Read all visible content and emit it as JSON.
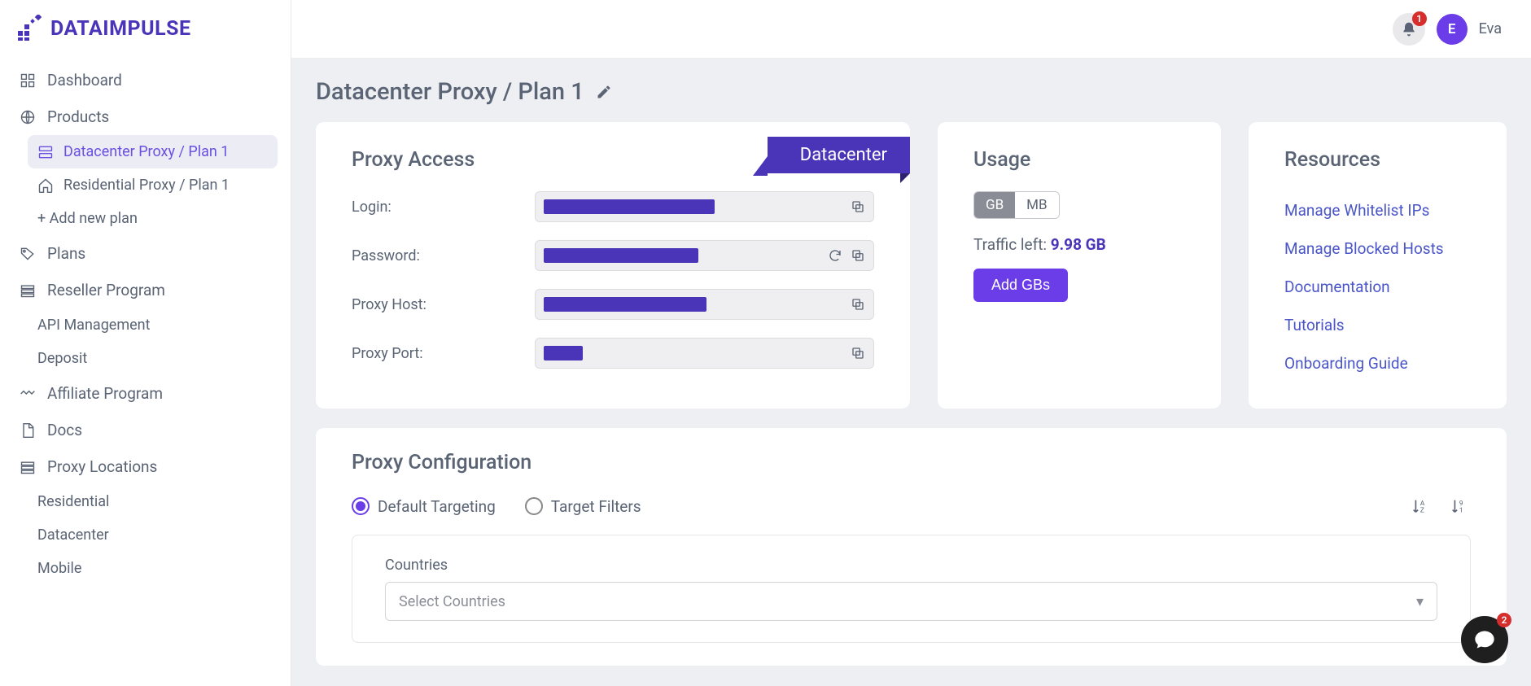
{
  "brand": {
    "text": "DATAIMPULSE"
  },
  "topbar": {
    "bell_badge": "1",
    "avatar_initial": "E",
    "username": "Eva"
  },
  "sidebar": {
    "dashboard": "Dashboard",
    "products": "Products",
    "product_items": {
      "dc": "Datacenter Proxy / Plan 1",
      "res": "Residential Proxy / Plan 1",
      "add": "+ Add new plan"
    },
    "plans": "Plans",
    "reseller": "Reseller Program",
    "reseller_items": {
      "api": "API Management",
      "deposit": "Deposit"
    },
    "affiliate": "Affiliate Program",
    "docs": "Docs",
    "locations": "Proxy Locations",
    "location_items": {
      "res": "Residential",
      "dc": "Datacenter",
      "mob": "Mobile"
    }
  },
  "page": {
    "title": "Datacenter Proxy / Plan 1"
  },
  "proxy_access": {
    "title": "Proxy Access",
    "ribbon": "Datacenter",
    "fields": {
      "login": "Login:",
      "password": "Password:",
      "host": "Proxy Host:",
      "port": "Proxy Port:"
    }
  },
  "usage": {
    "title": "Usage",
    "unit_gb": "GB",
    "unit_mb": "MB",
    "traffic_label": "Traffic left: ",
    "traffic_value": "9.98 GB",
    "add_btn": "Add GBs"
  },
  "resources": {
    "title": "Resources",
    "links": {
      "whitelist": "Manage Whitelist IPs",
      "blocked": "Manage Blocked Hosts",
      "docs": "Documentation",
      "tutorials": "Tutorials",
      "onboarding": "Onboarding Guide"
    }
  },
  "config": {
    "title": "Proxy Configuration",
    "default": "Default Targeting",
    "filters": "Target Filters",
    "countries_label": "Countries",
    "countries_placeholder": "Select Countries"
  },
  "chat_badge": "2"
}
